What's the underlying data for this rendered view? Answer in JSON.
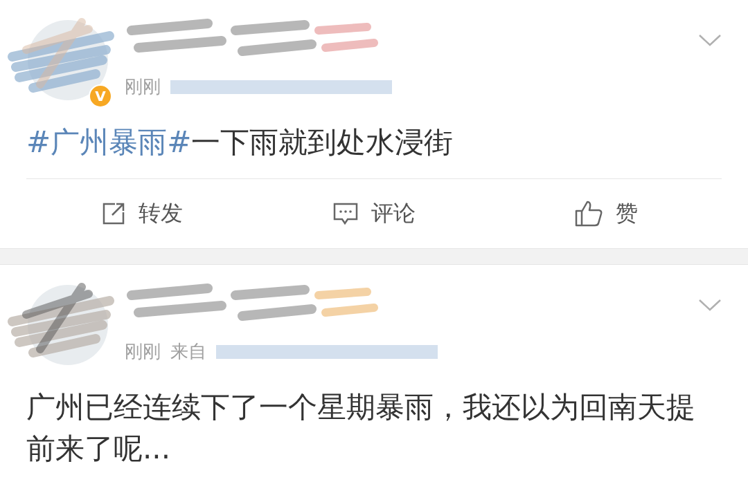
{
  "posts": [
    {
      "verified_badge": "V",
      "time": "刚刚",
      "topic": "#广州暴雨#",
      "text": "一下雨就到处水浸街",
      "actions": [
        {
          "kind": "repost",
          "label": "转发"
        },
        {
          "kind": "comment",
          "label": "评论"
        },
        {
          "kind": "like",
          "label": "赞"
        }
      ]
    },
    {
      "time": "刚刚",
      "source_label": "来自",
      "text": "广州已经连续下了一个星期暴雨，我还以为回南天提前来了呢..."
    }
  ]
}
